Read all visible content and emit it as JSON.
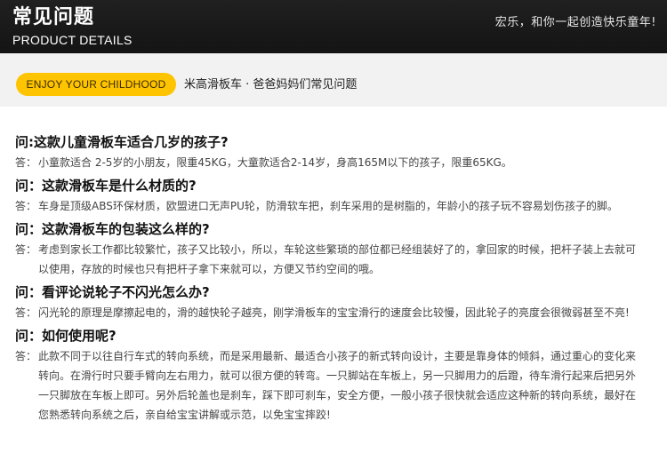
{
  "header": {
    "title": "常见问题",
    "subtitle": "PRODUCT DETAILS",
    "slogan": "宏乐，和你一起创造快乐童年!"
  },
  "intro": {
    "badge": "ENJOY YOUR CHILDHOOD",
    "text": "米高滑板车 · 爸爸妈妈们常见问题"
  },
  "answer_label": "答：",
  "faq": [
    {
      "question": "问:这款儿童滑板车适合几岁的孩子?",
      "answer": "小童款适合 2-5岁的小朋友，限重45KG，大童款适合2-14岁，身高165M以下的孩子，限重65KG。"
    },
    {
      "question": "问：这款滑板车是什么材质的?",
      "answer": "车身是顶级ABS环保材质，欧盟进口无声PU轮，防滑软车把，刹车采用的是树脂的，年龄小的孩子玩不容易划伤孩子的脚。"
    },
    {
      "question": "问：这款滑板车的包装这么样的?",
      "answer": "考虑到家长工作都比较繁忙，孩子又比较小，所以，车轮这些繁琐的部位都已经组装好了的，拿回家的时候，把杆子装上去就可以使用，存放的时候也只有把杆子拿下来就可以，方便又节约空间的哦。"
    },
    {
      "question": "问：看评论说轮子不闪光怎么办?",
      "answer": "闪光轮的原理是摩擦起电的，滑的越快轮子越亮，刚学滑板车的宝宝滑行的速度会比较慢，因此轮子的亮度会很微弱甚至不亮!"
    },
    {
      "question": "问：如何使用呢?",
      "answer": "此款不同于以往自行车式的转向系统，而是采用最新、最适合小孩子的新式转向设计，主要是靠身体的倾斜，通过重心的变化来转向。在滑行时只要手臂向左右用力，就可以很方便的转弯。一只脚站在车板上，另一只脚用力的后蹬，待车滑行起来后把另外一只脚放在车板上即可。另外后轮盖也是刹车，踩下即可刹车，安全方便，一般小孩子很快就会适应这种新的转向系统，最好在您熟悉转向系统之后，亲自给宝宝讲解或示范，以免宝宝摔跤!"
    }
  ]
}
